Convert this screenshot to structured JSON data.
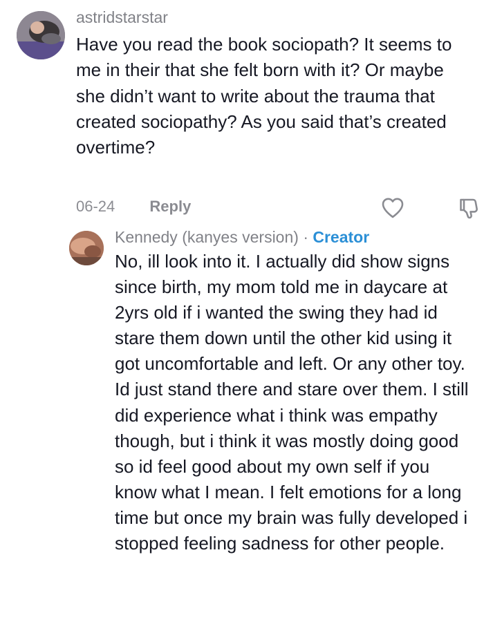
{
  "comments": [
    {
      "username": "astridstarstar",
      "text": "Have you read the book sociopath? It seems to me in their that she felt born with it? Or maybe she didn’t want to write about the trauma that created sociopathy? As you said that’s created overtime?",
      "date": "06-24",
      "reply_label": "Reply",
      "like_icon": "heart-outline-icon",
      "dislike_icon": "thumbs-down-icon"
    }
  ],
  "reply": {
    "username": "Kennedy (kanyes version)",
    "separator": "·",
    "badge": "Creator",
    "text": "No, ill look into it. I actually did show signs since birth, my mom told me in daycare at 2yrs old if i wanted the swing they had id stare them down until the other kid using it got uncomfortable and left. Or any other toy. Id just stand there and stare over them. I still did experience what i think was empathy though, but i think it was mostly doing good so id feel good about my own self if you know what I mean. I felt emotions for a long time but once my brain was fully developed i stopped feeling sadness for other people."
  },
  "colors": {
    "badge": "#2b8fd6",
    "muted_text": "#8a8b91",
    "body_text": "#161823"
  }
}
